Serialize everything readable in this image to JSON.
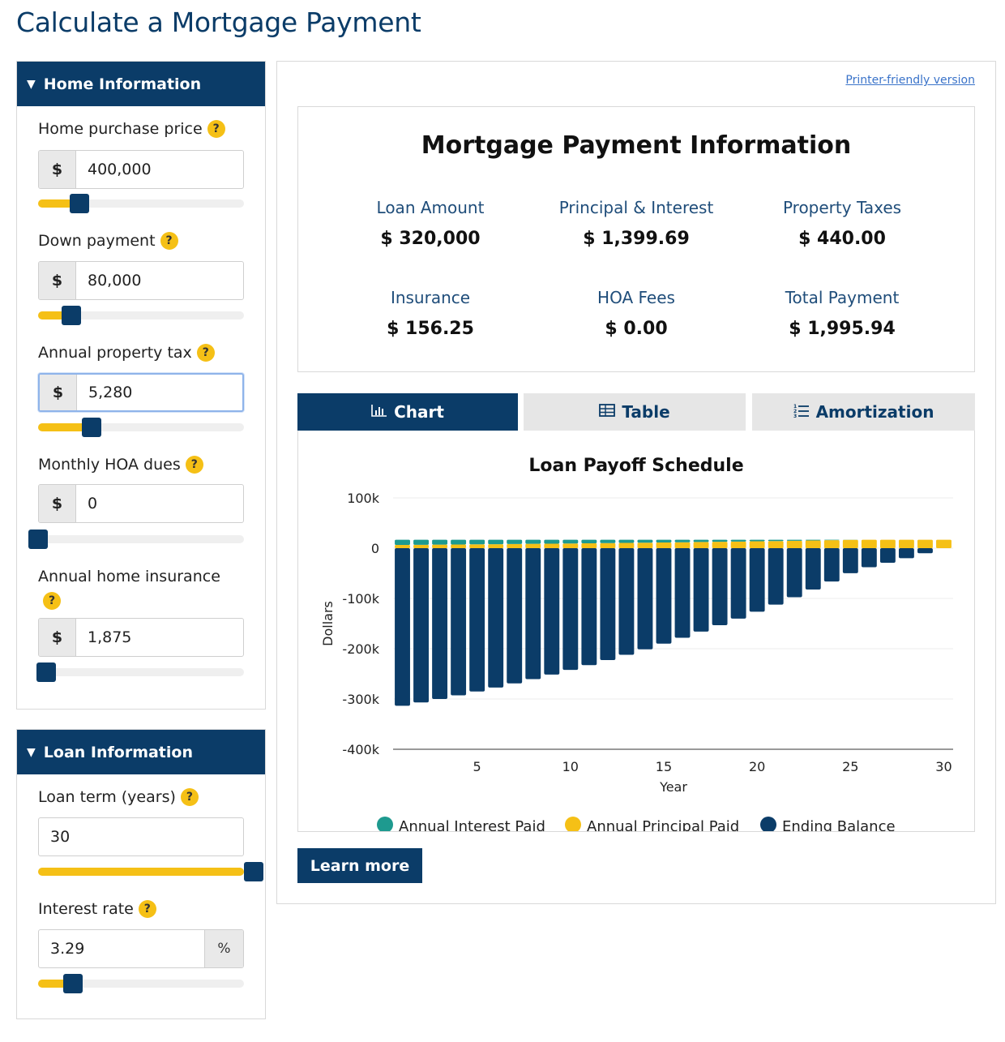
{
  "page": {
    "title": "Calculate a Mortgage Payment"
  },
  "home_info": {
    "header": "Home Information",
    "fields": [
      {
        "label": "Home purchase price",
        "prefix": "$",
        "value": "400,000",
        "slider_fraction": 0.2
      },
      {
        "label": "Down payment",
        "prefix": "$",
        "value": "80,000",
        "slider_fraction": 0.16
      },
      {
        "label": "Annual property tax",
        "prefix": "$",
        "value": "5,280",
        "slider_fraction": 0.26
      },
      {
        "label": "Monthly HOA dues",
        "prefix": "$",
        "value": "0",
        "slider_fraction": 0.0
      },
      {
        "label": "Annual home insurance",
        "prefix": "$",
        "value": "1,875",
        "slider_fraction": 0.04
      }
    ]
  },
  "loan_info": {
    "header": "Loan Information",
    "fields": [
      {
        "label": "Loan term (years)",
        "value": "30",
        "slider_fraction": 1.0
      },
      {
        "label": "Interest rate",
        "value": "3.29",
        "suffix": "%",
        "slider_fraction": 0.17
      }
    ]
  },
  "printer_link": "Printer-friendly version",
  "payment_info": {
    "title": "Mortgage Payment Information",
    "items": [
      {
        "label": "Loan Amount",
        "value": "$ 320,000"
      },
      {
        "label": "Principal & Interest",
        "value": "$ 1,399.69"
      },
      {
        "label": "Property Taxes",
        "value": "$ 440.00"
      },
      {
        "label": "Insurance",
        "value": "$ 156.25"
      },
      {
        "label": "HOA Fees",
        "value": "$ 0.00"
      },
      {
        "label": "Total Payment",
        "value": "$ 1,995.94"
      }
    ]
  },
  "tabs": [
    {
      "label": "Chart",
      "icon": "bar-chart-icon",
      "active": true
    },
    {
      "label": "Table",
      "icon": "table-icon",
      "active": false
    },
    {
      "label": "Amortization",
      "icon": "list-icon",
      "active": false
    }
  ],
  "learn_more": "Learn more",
  "colors": {
    "navy": "#0b3c68",
    "yellow": "#f5c016",
    "teal": "#1e9a8f"
  },
  "chart_data": {
    "type": "bar",
    "title": "Loan Payoff Schedule",
    "xlabel": "Year",
    "ylabel": "Dollars",
    "ylim": [
      -400000,
      100000
    ],
    "yticks": [
      100000,
      0,
      -100000,
      -200000,
      -300000,
      -400000
    ],
    "ytick_labels": [
      "100k",
      "0",
      "-100k",
      "-200k",
      "-300k",
      "-400k"
    ],
    "xticks": [
      5,
      10,
      15,
      20,
      25,
      30
    ],
    "x": [
      1,
      2,
      3,
      4,
      5,
      6,
      7,
      8,
      9,
      10,
      11,
      12,
      13,
      14,
      15,
      16,
      17,
      18,
      19,
      20,
      21,
      22,
      23,
      24,
      25,
      26,
      27,
      28,
      29,
      30
    ],
    "legend_position": "bottom",
    "series": [
      {
        "name": "Annual Interest Paid",
        "color": "#1e9a8f",
        "values": [
          10400,
          10120,
          9830,
          9530,
          9220,
          8900,
          8570,
          8230,
          7880,
          7520,
          7140,
          6750,
          6350,
          5930,
          5500,
          5060,
          4600,
          4120,
          3630,
          3120,
          2600,
          2060,
          1500,
          920,
          330,
          0,
          0,
          0,
          0,
          0
        ]
      },
      {
        "name": "Annual Principal Paid",
        "color": "#f5c016",
        "values": [
          6400,
          6680,
          6970,
          7270,
          7580,
          7900,
          8230,
          8570,
          8920,
          9280,
          9660,
          10050,
          10450,
          10870,
          11300,
          11740,
          12200,
          12680,
          13170,
          13680,
          14200,
          14740,
          15300,
          15880,
          16470,
          16800,
          16800,
          16800,
          16800,
          16800
        ]
      },
      {
        "name": "Ending Balance",
        "color": "#0b3c68",
        "values": [
          -313600,
          -306900,
          -299900,
          -292700,
          -285100,
          -277200,
          -269000,
          -260400,
          -251500,
          -242200,
          -232600,
          -222500,
          -212100,
          -201200,
          -189900,
          -178200,
          -166000,
          -153300,
          -140100,
          -126400,
          -112200,
          -97500,
          -82200,
          -66300,
          -49800,
          -38000,
          -29000,
          -20000,
          -10000,
          0
        ]
      }
    ]
  }
}
